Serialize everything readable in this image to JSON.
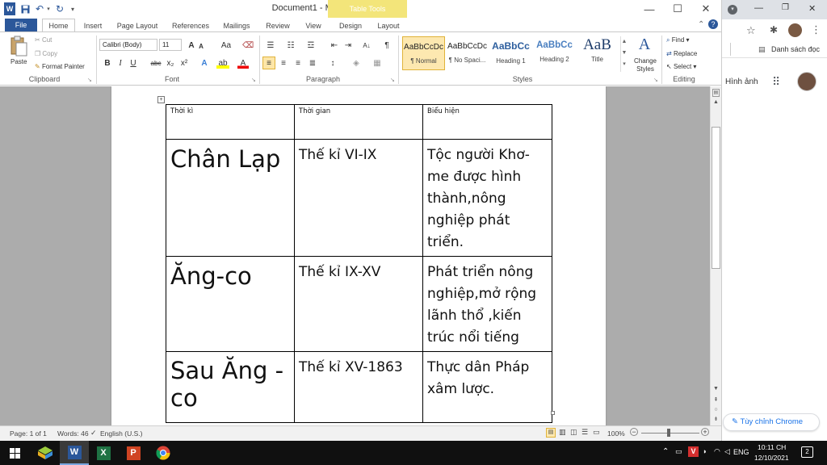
{
  "word": {
    "quick_access": {
      "app_icon": "W",
      "save_icon": "save-icon",
      "undo_icon": "undo-icon",
      "redo_icon": "redo-icon"
    },
    "title": "Document1 - Microsoft Word",
    "context_tab": "Table Tools",
    "window_controls": {
      "minimize": "—",
      "maximize": "☐",
      "close": "✕"
    },
    "tabs": [
      "File",
      "Home",
      "Insert",
      "Page Layout",
      "References",
      "Mailings",
      "Review",
      "View",
      "Design",
      "Layout"
    ],
    "clipboard": {
      "paste": "Paste",
      "cut": "Cut",
      "copy": "Copy",
      "format_painter": "Format Painter",
      "label": "Clipboard"
    },
    "font": {
      "name": "Calibri (Body)",
      "size": "11",
      "label": "Font",
      "grow": "A",
      "shrink": "A",
      "case": "Aa",
      "bold": "B",
      "italic": "I",
      "underline": "U",
      "strike": "abc",
      "sub": "x₂",
      "sup": "x²",
      "effects": "A",
      "highlight": "ab",
      "color": "A"
    },
    "paragraph": {
      "label": "Paragraph",
      "sort": "A↓",
      "pilcrow": "¶"
    },
    "styles": {
      "label": "Styles",
      "items": [
        {
          "preview": "AaBbCcDc",
          "name": "¶ Normal"
        },
        {
          "preview": "AaBbCcDc",
          "name": "¶ No Spaci..."
        },
        {
          "preview": "AaBbCc",
          "name": "Heading 1"
        },
        {
          "preview": "AaBbCc",
          "name": "Heading 2"
        },
        {
          "preview": "AaB",
          "name": "Title"
        }
      ],
      "change_styles": "Change Styles",
      "change_styles_letter": "A"
    },
    "editing": {
      "find": "Find",
      "replace": "Replace",
      "select": "Select",
      "label": "Editing"
    },
    "table": {
      "headers": [
        "Thời kì",
        "Thời gian",
        "Biểu hiện"
      ],
      "rows": [
        {
          "period": "Chân Lạp",
          "time": "Thế kỉ VI-IX",
          "detail": "Tộc người Khơ-me được hình thành,nông nghiệp phát triển."
        },
        {
          "period": "Ăng-co",
          "time": "Thế kỉ IX-XV",
          "detail": "Phát triển nông nghiệp,mở rộng lãnh thổ ,kiến trúc nổi tiếng"
        },
        {
          "period": "Sau Ăng -co",
          "time": "Thế kỉ XV-1863",
          "detail": "Thực dân Pháp xâm lược."
        }
      ]
    },
    "status": {
      "page": "Page: 1 of 1",
      "words": "Words: 46",
      "language": "English (U.S.)",
      "zoom": "100%"
    }
  },
  "chrome": {
    "window_controls": {
      "minimize": "—",
      "restore": "❐",
      "close": "✕"
    },
    "reading_list": "Danh sách đọc",
    "images_link": "Hình ảnh",
    "customize": "Tùy chỉnh Chrome"
  },
  "taskbar": {
    "language": "ENG",
    "time": "10:11 CH",
    "date": "12/10/2021",
    "notifications": "2"
  },
  "colors": {
    "word_blue": "#2b579a",
    "table_tools": "#f3e57a",
    "taskbar": "#101010"
  }
}
